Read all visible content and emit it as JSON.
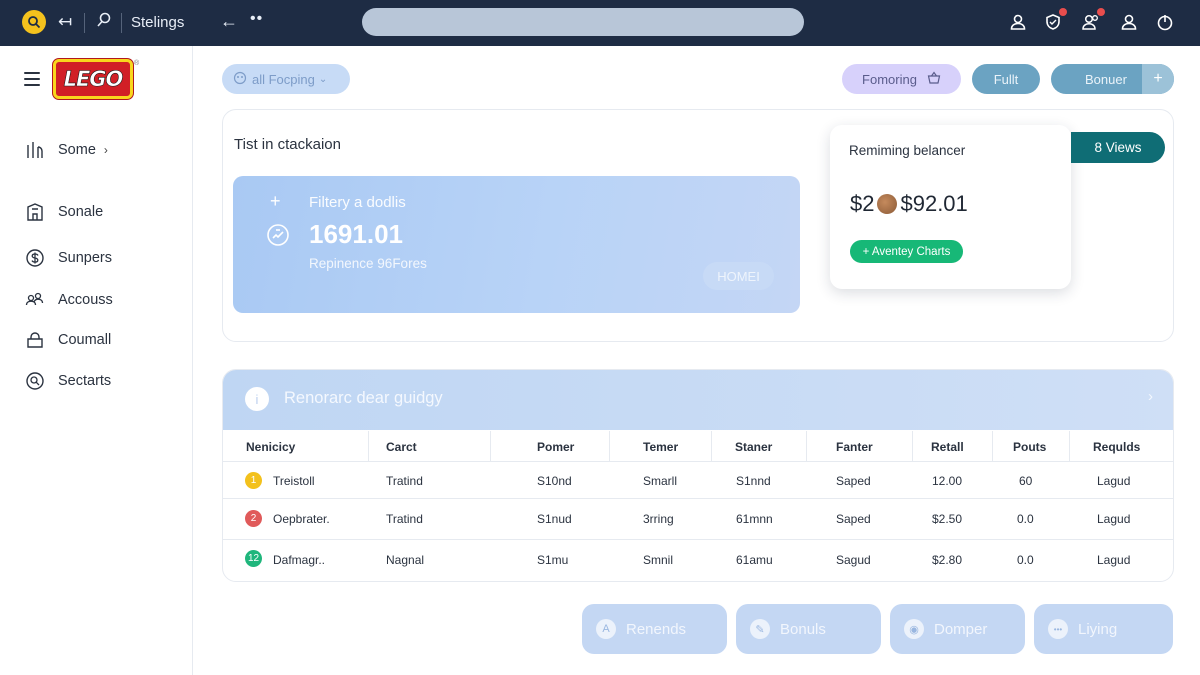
{
  "topbar": {
    "title": "Stelings"
  },
  "sidebar": {
    "logo_text": "LEGO",
    "logo_reg": "®",
    "items": [
      {
        "label": "Some",
        "icon": "bars-chart-icon"
      },
      {
        "label": "Sonale",
        "icon": "building-icon"
      },
      {
        "label": "Sunpers",
        "icon": "dollar-circle-icon"
      },
      {
        "label": "Accouss",
        "icon": "people-icon"
      },
      {
        "label": "Coumall",
        "icon": "bag-icon"
      },
      {
        "label": "Sectarts",
        "icon": "search-circle-icon"
      }
    ]
  },
  "toolbar": {
    "filter_label": "all Focping",
    "fomoring_label": "Fomoring",
    "full_label": "Fullt",
    "bonuer_label": "Bonuer"
  },
  "overview": {
    "title": "Tist in ctackaion",
    "hero": {
      "subtitle": "Filtery a dodlis",
      "value": "1691.01",
      "caption": "Repinence 96Fores",
      "button": "HOMEI"
    },
    "balance": {
      "label": "Remiming belancer",
      "value_prefix": "$2",
      "value_suffix": "$92.01",
      "button": "+ Aventey Charts"
    },
    "views_button": "8 Views"
  },
  "table": {
    "banner": "Renorarc dear guidgy",
    "info_glyph": "i",
    "columns": [
      "Nenicicy",
      "Carct",
      "Pomer",
      "Temer",
      "Staner",
      "Fanter",
      "Retall",
      "Pouts",
      "Requlds"
    ],
    "rows": [
      {
        "badge": "1",
        "badge_color": "#f3c11c",
        "cells": [
          "Treistoll",
          "Tratind",
          "S10nd",
          "Smarll",
          "S1nnd",
          "Saped",
          "12.00",
          "60",
          "Lagud"
        ]
      },
      {
        "badge": "2",
        "badge_color": "#e05a5a",
        "cells": [
          "Oepbrater.",
          "Tratind",
          "S1nud",
          "3rring",
          "61mnn",
          "Saped",
          "$2.50",
          "0.0",
          "Lagud"
        ]
      },
      {
        "badge": "12",
        "badge_color": "#1fb67c",
        "cells": [
          "Dafmagr..",
          "Nagnal",
          "S1mu",
          "Smnil",
          "61amu",
          "Sagud",
          "$2.80",
          "0.0",
          "Lagud"
        ]
      }
    ]
  },
  "bottom_actions": [
    {
      "label": "Renends",
      "glyph": "A"
    },
    {
      "label": "Bonuls",
      "glyph": "✎"
    },
    {
      "label": "Domper",
      "glyph": "◉"
    },
    {
      "label": "Liying",
      "glyph": "•••"
    }
  ]
}
